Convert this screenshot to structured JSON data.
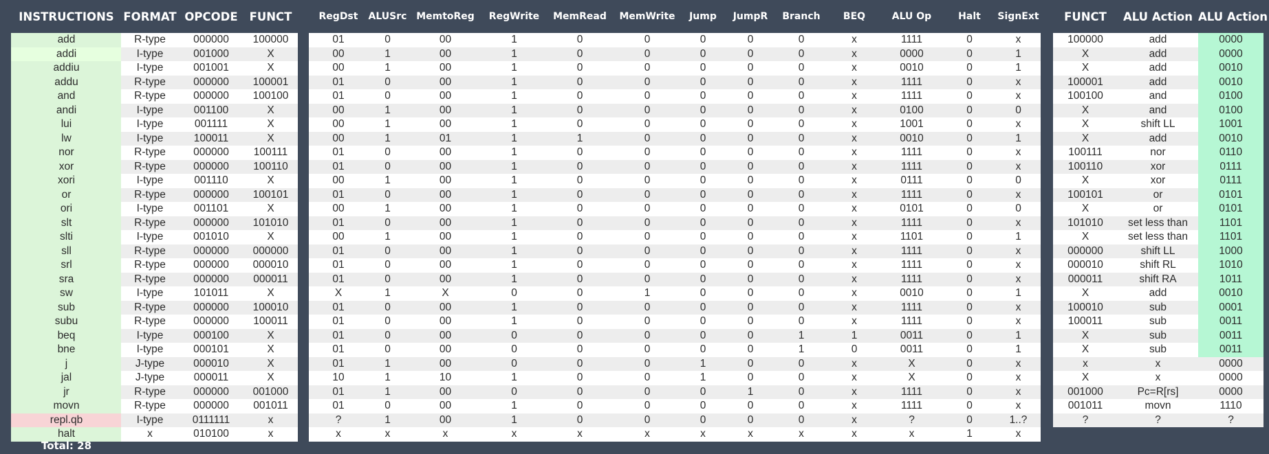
{
  "instructions": {
    "header": "INSTRUCTIONS",
    "total": "Total: 28",
    "items": [
      "add",
      "addi",
      "addiu",
      "addu",
      "and",
      "andi",
      "lui",
      "lw",
      "nor",
      "xor",
      "xori",
      "or",
      "ori",
      "slt",
      "slti",
      "sll",
      "srl",
      "sra",
      "sw",
      "sub",
      "subu",
      "beq",
      "bne",
      "j",
      "jal",
      "jr",
      "movn",
      "repl.qb",
      "halt"
    ],
    "colors": {
      "normal": "#dcf5d9",
      "highlight": "#e6ffdf",
      "flagged": "#f8d4d6"
    },
    "highlighted_index": 1,
    "flagged_index": 27
  },
  "format": {
    "headers": [
      "FORMAT",
      "OPCODE",
      "FUNCT"
    ],
    "rows": [
      [
        "R-type",
        "000000",
        "100000"
      ],
      [
        "I-type",
        "001000",
        "X"
      ],
      [
        "I-type",
        "001001",
        "X"
      ],
      [
        "R-type",
        "000000",
        "100001"
      ],
      [
        "R-type",
        "000000",
        "100100"
      ],
      [
        "I-type",
        "001100",
        "X"
      ],
      [
        "I-type",
        "001111",
        "X"
      ],
      [
        "I-type",
        "100011",
        "X"
      ],
      [
        "R-type",
        "000000",
        "100111"
      ],
      [
        "R-type",
        "000000",
        "100110"
      ],
      [
        "I-type",
        "001110",
        "X"
      ],
      [
        "R-type",
        "000000",
        "100101"
      ],
      [
        "I-type",
        "001101",
        "X"
      ],
      [
        "R-type",
        "000000",
        "101010"
      ],
      [
        "I-type",
        "001010",
        "X"
      ],
      [
        "R-type",
        "000000",
        "000000"
      ],
      [
        "R-type",
        "000000",
        "000010"
      ],
      [
        "R-type",
        "000000",
        "000011"
      ],
      [
        "I-type",
        "101011",
        "X"
      ],
      [
        "R-type",
        "000000",
        "100010"
      ],
      [
        "R-type",
        "000000",
        "100011"
      ],
      [
        "I-type",
        "000100",
        "X"
      ],
      [
        "I-type",
        "000101",
        "X"
      ],
      [
        "J-type",
        "000010",
        "X"
      ],
      [
        "J-type",
        "000011",
        "X"
      ],
      [
        "R-type",
        "000000",
        "001000"
      ],
      [
        "R-type",
        "000000",
        "001011"
      ],
      [
        "I-type",
        "0111111",
        "x"
      ],
      [
        "x",
        "010100",
        "x"
      ]
    ]
  },
  "control": {
    "headers": [
      "RegDst",
      "ALUSrc",
      "MemtoReg",
      "RegWrite",
      "MemRead",
      "MemWrite",
      "Jump",
      "JumpR",
      "Branch",
      "BEQ",
      "ALU Op",
      "Halt",
      "SignExt"
    ],
    "rows": [
      [
        "01",
        "0",
        "00",
        "1",
        "0",
        "0",
        "0",
        "0",
        "0",
        "x",
        "1111",
        "0",
        "x"
      ],
      [
        "00",
        "1",
        "00",
        "1",
        "0",
        "0",
        "0",
        "0",
        "0",
        "x",
        "0000",
        "0",
        "1"
      ],
      [
        "00",
        "1",
        "00",
        "1",
        "0",
        "0",
        "0",
        "0",
        "0",
        "x",
        "0010",
        "0",
        "1"
      ],
      [
        "01",
        "0",
        "00",
        "1",
        "0",
        "0",
        "0",
        "0",
        "0",
        "x",
        "1111",
        "0",
        "x"
      ],
      [
        "01",
        "0",
        "00",
        "1",
        "0",
        "0",
        "0",
        "0",
        "0",
        "x",
        "1111",
        "0",
        "x"
      ],
      [
        "00",
        "1",
        "00",
        "1",
        "0",
        "0",
        "0",
        "0",
        "0",
        "x",
        "0100",
        "0",
        "0"
      ],
      [
        "00",
        "1",
        "00",
        "1",
        "0",
        "0",
        "0",
        "0",
        "0",
        "x",
        "1001",
        "0",
        "x"
      ],
      [
        "00",
        "1",
        "01",
        "1",
        "1",
        "0",
        "0",
        "0",
        "0",
        "x",
        "0010",
        "0",
        "1"
      ],
      [
        "01",
        "0",
        "00",
        "1",
        "0",
        "0",
        "0",
        "0",
        "0",
        "x",
        "1111",
        "0",
        "x"
      ],
      [
        "01",
        "0",
        "00",
        "1",
        "0",
        "0",
        "0",
        "0",
        "0",
        "x",
        "1111",
        "0",
        "x"
      ],
      [
        "00",
        "1",
        "00",
        "1",
        "0",
        "0",
        "0",
        "0",
        "0",
        "x",
        "0111",
        "0",
        "0"
      ],
      [
        "01",
        "0",
        "00",
        "1",
        "0",
        "0",
        "0",
        "0",
        "0",
        "x",
        "1111",
        "0",
        "x"
      ],
      [
        "00",
        "1",
        "00",
        "1",
        "0",
        "0",
        "0",
        "0",
        "0",
        "x",
        "0101",
        "0",
        "0"
      ],
      [
        "01",
        "0",
        "00",
        "1",
        "0",
        "0",
        "0",
        "0",
        "0",
        "x",
        "1111",
        "0",
        "x"
      ],
      [
        "00",
        "1",
        "00",
        "1",
        "0",
        "0",
        "0",
        "0",
        "0",
        "x",
        "1101",
        "0",
        "1"
      ],
      [
        "01",
        "0",
        "00",
        "1",
        "0",
        "0",
        "0",
        "0",
        "0",
        "x",
        "1111",
        "0",
        "x"
      ],
      [
        "01",
        "0",
        "00",
        "1",
        "0",
        "0",
        "0",
        "0",
        "0",
        "x",
        "1111",
        "0",
        "x"
      ],
      [
        "01",
        "0",
        "00",
        "1",
        "0",
        "0",
        "0",
        "0",
        "0",
        "x",
        "1111",
        "0",
        "x"
      ],
      [
        "X",
        "1",
        "X",
        "0",
        "0",
        "1",
        "0",
        "0",
        "0",
        "x",
        "0010",
        "0",
        "1"
      ],
      [
        "01",
        "0",
        "00",
        "1",
        "0",
        "0",
        "0",
        "0",
        "0",
        "x",
        "1111",
        "0",
        "x"
      ],
      [
        "01",
        "0",
        "00",
        "1",
        "0",
        "0",
        "0",
        "0",
        "0",
        "x",
        "1111",
        "0",
        "x"
      ],
      [
        "01",
        "0",
        "00",
        "0",
        "0",
        "0",
        "0",
        "0",
        "1",
        "1",
        "0011",
        "0",
        "1"
      ],
      [
        "01",
        "0",
        "00",
        "0",
        "0",
        "0",
        "0",
        "0",
        "1",
        "0",
        "0011",
        "0",
        "1"
      ],
      [
        "01",
        "1",
        "00",
        "0",
        "0",
        "0",
        "1",
        "0",
        "0",
        "x",
        "X",
        "0",
        "x"
      ],
      [
        "10",
        "1",
        "10",
        "1",
        "0",
        "0",
        "1",
        "0",
        "0",
        "x",
        "X",
        "0",
        "x"
      ],
      [
        "01",
        "1",
        "00",
        "0",
        "0",
        "0",
        "0",
        "1",
        "0",
        "x",
        "1111",
        "0",
        "x"
      ],
      [
        "01",
        "0",
        "00",
        "1",
        "0",
        "0",
        "0",
        "0",
        "0",
        "x",
        "1111",
        "0",
        "x"
      ],
      [
        "?",
        "1",
        "00",
        "1",
        "0",
        "0",
        "0",
        "0",
        "0",
        "x",
        "?",
        "0",
        "1..?"
      ],
      [
        "x",
        "x",
        "x",
        "x",
        "x",
        "x",
        "x",
        "x",
        "x",
        "x",
        "x",
        "1",
        "x"
      ]
    ]
  },
  "alu": {
    "headers": [
      "FUNCT",
      "ALU Action",
      "ALU Action"
    ],
    "accent_color": "#b6f7d4",
    "accent_rows": 23,
    "rows": [
      [
        "100000",
        "add",
        "0000"
      ],
      [
        "X",
        "add",
        "0000"
      ],
      [
        "X",
        "add",
        "0010"
      ],
      [
        "100001",
        "add",
        "0010"
      ],
      [
        "100100",
        "and",
        "0100"
      ],
      [
        "X",
        "and",
        "0100"
      ],
      [
        "X",
        "shift LL",
        "1001"
      ],
      [
        "X",
        "add",
        "0010"
      ],
      [
        "100111",
        "nor",
        "0110"
      ],
      [
        "100110",
        "xor",
        "0111"
      ],
      [
        "X",
        "xor",
        "0111"
      ],
      [
        "100101",
        "or",
        "0101"
      ],
      [
        "X",
        "or",
        "0101"
      ],
      [
        "101010",
        "set less than",
        "1101"
      ],
      [
        "X",
        "set less than",
        "1101"
      ],
      [
        "000000",
        "shift LL",
        "1000"
      ],
      [
        "000010",
        "shift RL",
        "1010"
      ],
      [
        "000011",
        "shift RA",
        "1011"
      ],
      [
        "X",
        "add",
        "0010"
      ],
      [
        "100010",
        "sub",
        "0001"
      ],
      [
        "100011",
        "sub",
        "0011"
      ],
      [
        "X",
        "sub",
        "0011"
      ],
      [
        "X",
        "sub",
        "0011"
      ],
      [
        "x",
        "x",
        "0000"
      ],
      [
        "X",
        "x",
        "0000"
      ],
      [
        "001000",
        "Pc=R[rs]",
        "0000"
      ],
      [
        "001011",
        "movn",
        "1110"
      ],
      [
        "?",
        "?",
        "?"
      ]
    ]
  },
  "colors": {
    "band_white": "#ffffff",
    "band_gray": "#ededed",
    "background": "#3f4a5a"
  }
}
